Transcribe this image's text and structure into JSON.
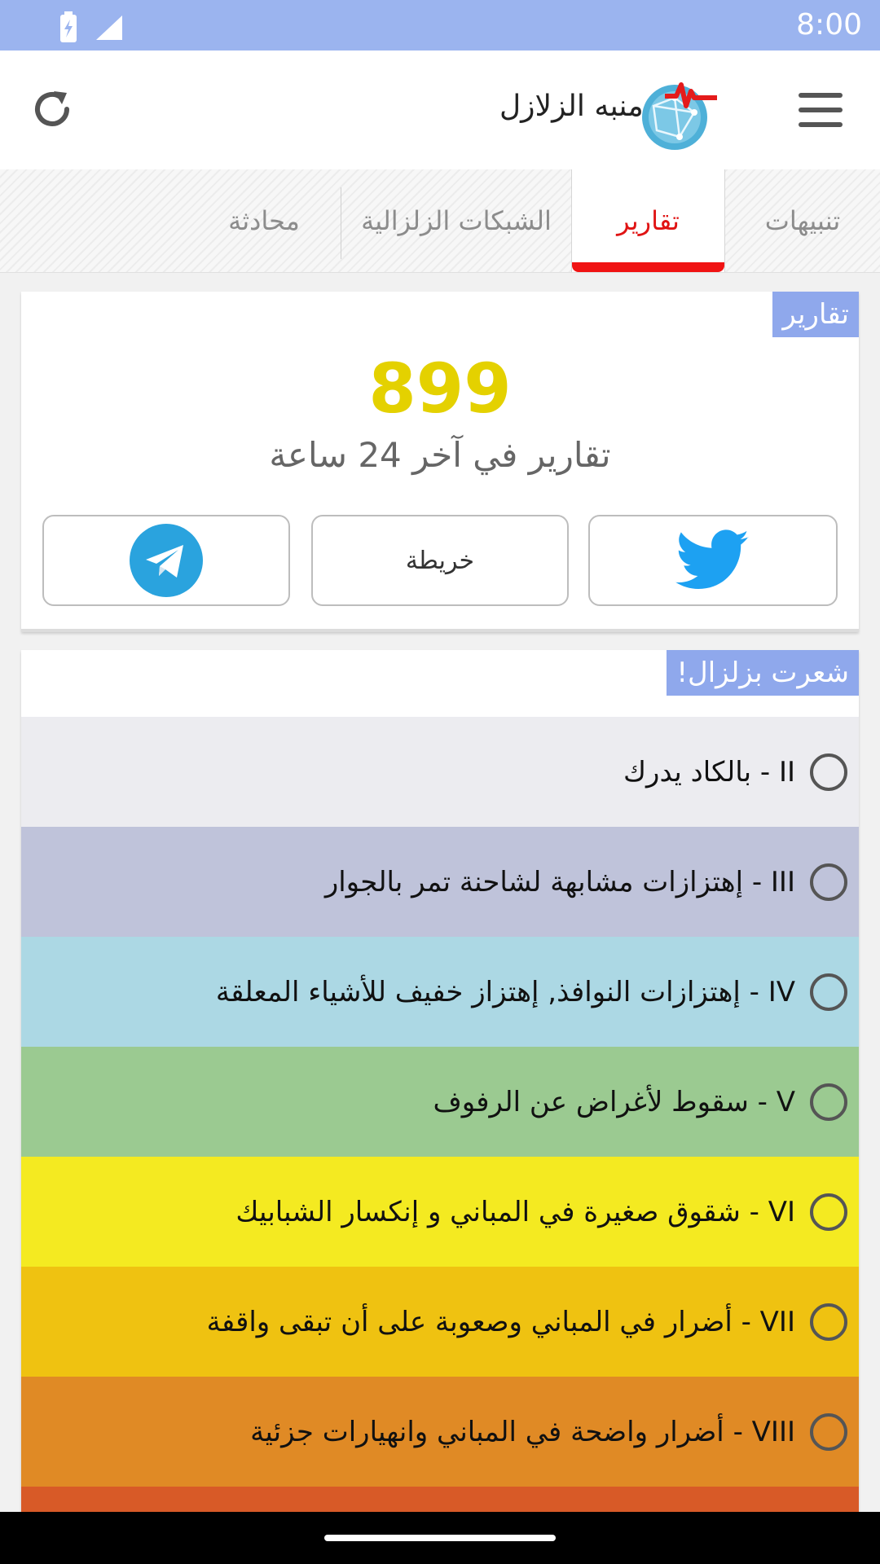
{
  "status_bar": {
    "time": "8:00",
    "icons": [
      "battery-charging-icon",
      "cell-signal-icon"
    ]
  },
  "app_bar": {
    "title": "منبه الزلازل",
    "icons": [
      "refresh-icon",
      "app-logo-icon",
      "menu-icon"
    ]
  },
  "tabs": [
    {
      "label": "تنبيهات",
      "active": false
    },
    {
      "label": "تقارير",
      "active": true
    },
    {
      "label": "الشبكات الزلزالية",
      "active": false
    },
    {
      "label": "محادثة",
      "active": false
    }
  ],
  "reports_card": {
    "label": "تقارير",
    "count": "899",
    "subtitle": "تقارير في آخر 24 ساعة",
    "buttons": {
      "twitter_icon": "twitter-icon",
      "map_label": "خريطة",
      "telegram_icon": "telegram-icon"
    }
  },
  "felt_card": {
    "label": "شعرت بزلزال!",
    "levels": [
      {
        "text": "II - بالكاد يدرك",
        "color": "#ececf0"
      },
      {
        "text": "III - إهتزازات مشابهة لشاحنة تمر بالجوار",
        "color": "#bfc3da"
      },
      {
        "text": "IV - إهتزازات النوافذ, إهتزاز خفيف للأشياء المعلقة",
        "color": "#acd8e4"
      },
      {
        "text": "V - سقوط لأغراض عن الرفوف",
        "color": "#9bca91"
      },
      {
        "text": "VI - شقوق صغيرة في المباني و إنكسار الشبابيك",
        "color": "#f4ea21"
      },
      {
        "text": "VII - أضرار في المباني وصعوبة على أن تبقى واقفة",
        "color": "#efc211"
      },
      {
        "text": "VIII - أضرار واضحة في المباني وانهيارات جزئية",
        "color": "#e08a25"
      },
      {
        "text": "",
        "color": "#d85a27"
      }
    ]
  },
  "colors": {
    "status_bar": "#9bb4ef",
    "accent_red": "#f01313",
    "count_yellow": "#e4d100",
    "label_blue": "#8fa8ec"
  }
}
